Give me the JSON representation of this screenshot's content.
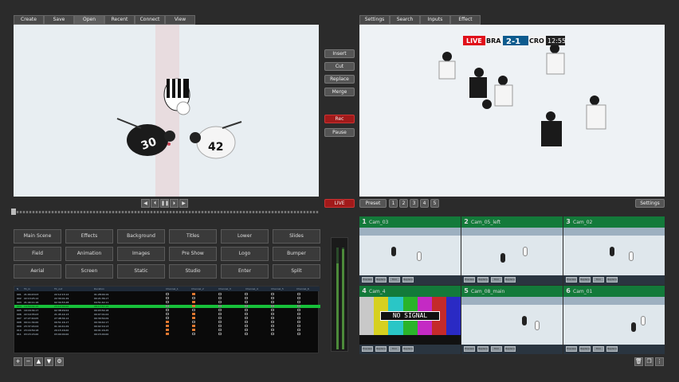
{
  "menu_tabs": [
    "Create",
    "Save",
    "Open",
    "Recent",
    "Connect",
    "View"
  ],
  "right_tabs": [
    "Settings",
    "Search",
    "Inputs",
    "Effect"
  ],
  "edit_controls": [
    "Insert",
    "Cut",
    "Replace",
    "Merge"
  ],
  "rec_label": "Rec",
  "pause_label": "Pause",
  "live_label": "LIVE",
  "scorebug": {
    "live": "LIVE",
    "team_a": "BRA",
    "score": "2-1",
    "team_b": "CRO",
    "clock": "12:55"
  },
  "player_numbers": {
    "left": "30",
    "right": "42"
  },
  "preset": {
    "label": "Preset",
    "numbers": [
      "1",
      "2",
      "3",
      "4",
      "5"
    ],
    "settings_label": "Settings"
  },
  "macro_buttons": [
    [
      "Main Scene",
      "Effects",
      "Background",
      "Titles",
      "Lower",
      "Slides"
    ],
    [
      "Field",
      "Animation",
      "Images",
      "Pre Show",
      "Logo",
      "Bumper"
    ],
    [
      "Aerial",
      "Screen",
      "Static",
      "Studio",
      "Enter",
      "Split"
    ]
  ],
  "timeline": {
    "headers": [
      "N",
      "TC_in",
      "TC_out",
      "Duration",
      "Channel_1",
      "Channel_2",
      "Channel_3",
      "Channel_4",
      "Channel_5",
      "Channel_6"
    ],
    "rows": [
      [
        "001",
        "21:04:43.03",
        "22:12:13.12",
        "01:28:00.19"
      ],
      [
        "002",
        "22:13:25.12",
        "22:34:01.29",
        "00:21:36.17"
      ],
      [
        "003",
        "21:44:11.16",
        "02:34:53.28",
        "04:51:42.11"
      ],
      [
        "004",
        "14:54:02.15",
        "23:12:00.00",
        "08:17:57.15"
      ],
      [
        "005",
        "19:16:34.17",
        "02:38:29.04",
        "00:03:54.18"
      ],
      [
        "006",
        "22:19:35.03",
        "21:45:14.13",
        "00:07:01.04"
      ],
      [
        "007",
        "27:27:40.05",
        "27:48:34.14",
        "00:30:54.09"
      ],
      [
        "008",
        "09:11:34.00",
        "09:51:16.17",
        "00:39:42.17"
      ],
      [
        "009",
        "23:37:24.04",
        "01:44:41.09",
        "00:02:19.13"
      ],
      [
        "010",
        "23:16:59.18",
        "20:15:16.00",
        "00:01:16.25"
      ],
      [
        "011",
        "03:15:15.00",
        "03:00:00.00",
        "00:15:00.00"
      ]
    ],
    "highlight_row": 3
  },
  "tools": [
    "+",
    "−",
    "▲",
    "▼",
    "⚙"
  ],
  "cameras": [
    {
      "num": "1",
      "name": "Cam_03"
    },
    {
      "num": "2",
      "name": "Cam_05_left"
    },
    {
      "num": "3",
      "name": "Cam_02"
    },
    {
      "num": "4",
      "name": "Cam_4"
    },
    {
      "num": "5",
      "name": "Cam_08_main"
    },
    {
      "num": "6",
      "name": "Cam_01"
    }
  ],
  "cam_foot_buttons": [
    "Preview",
    "Replace",
    "Trim",
    "Replace"
  ],
  "no_signal": "NO SIGNAL",
  "colors": {
    "accent": "#137a3a",
    "rec": "#a11a1a",
    "highlight": "#17c03a",
    "live_badge": "#e0101a"
  }
}
